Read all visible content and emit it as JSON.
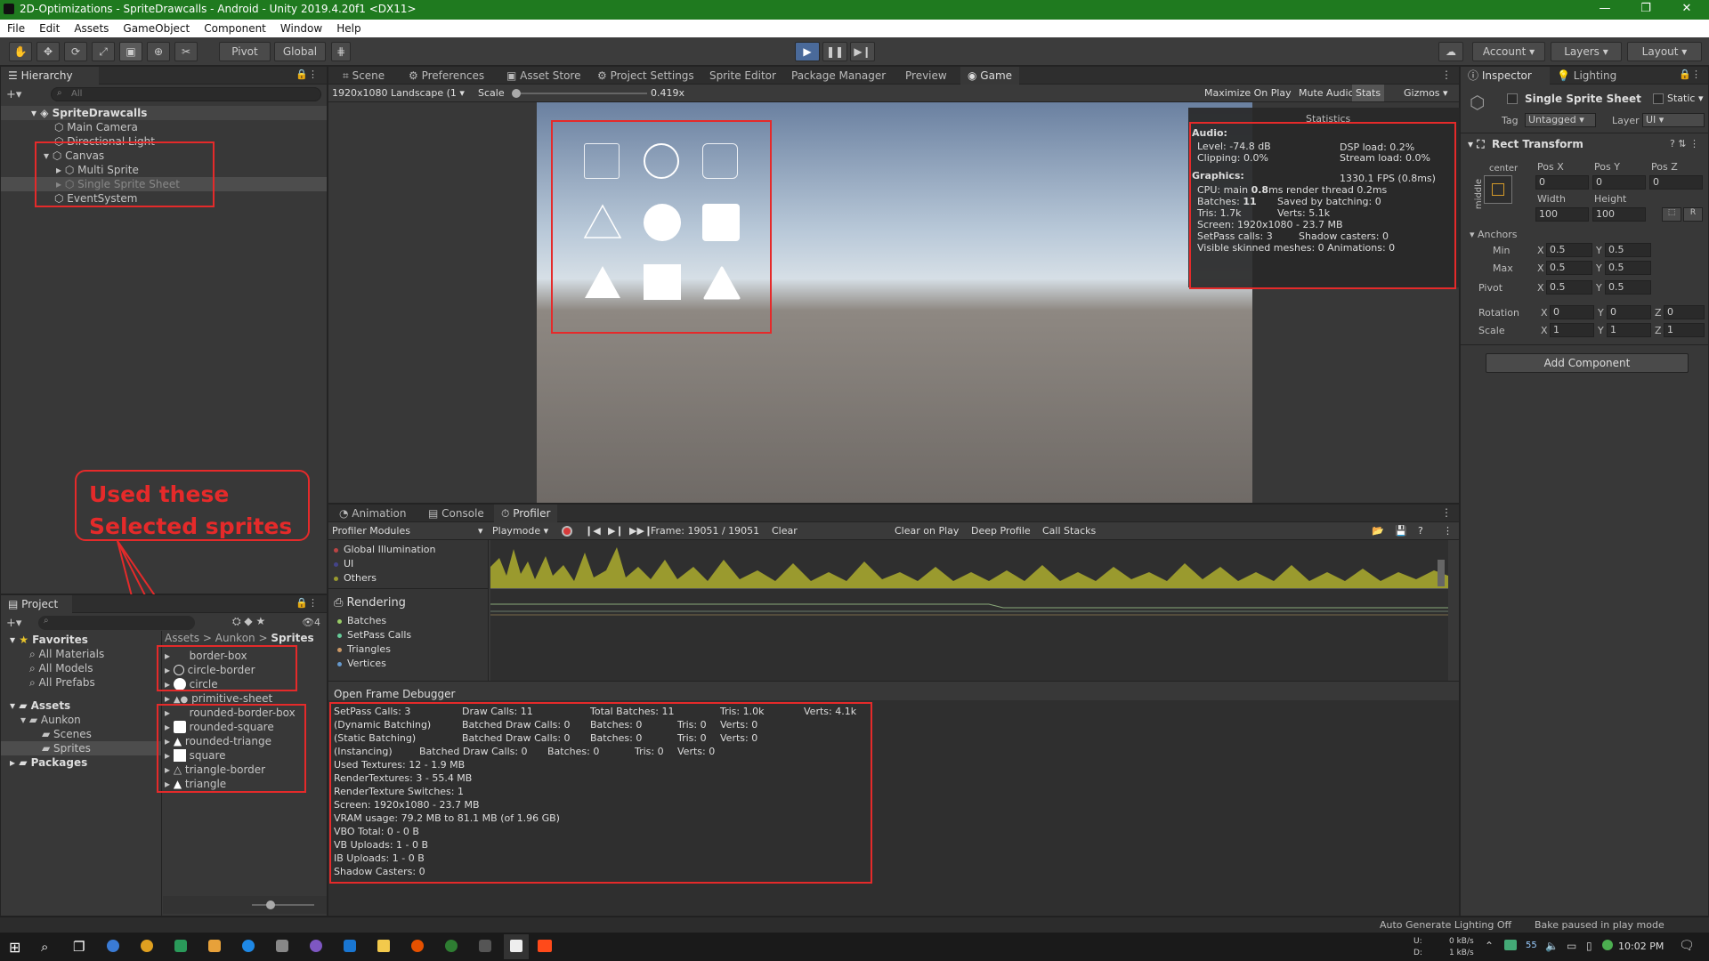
{
  "window": {
    "title": "2D-Optimizations - SpriteDrawcalls - Android - Unity 2019.4.20f1 <DX11>"
  },
  "menu": [
    "File",
    "Edit",
    "Assets",
    "GameObject",
    "Component",
    "Window",
    "Help"
  ],
  "toolbar": {
    "pivot": "Pivot",
    "global": "Global",
    "account": "Account",
    "layers": "Layers",
    "layout": "Layout"
  },
  "hierarchy": {
    "tab": "Hierarchy",
    "search_placeholder": "All",
    "items": [
      "SpriteDrawcalls",
      "Main Camera",
      "Directional Light",
      "Canvas",
      "Multi Sprite",
      "Single Sprite Sheet",
      "EventSystem"
    ]
  },
  "center_tabs": [
    "Scene",
    "Preferences",
    "Asset Store",
    "Project Settings",
    "Sprite Editor",
    "Package Manager",
    "Preview",
    "Game"
  ],
  "game_bar": {
    "resolution": "1920x1080 Landscape (1",
    "scale_label": "Scale",
    "scale_value": "0.419x",
    "maximize": "Maximize On Play",
    "mute": "Mute Audio",
    "stats": "Stats",
    "gizmos": "Gizmos"
  },
  "stats": {
    "title": "Statistics",
    "audio": "Audio:",
    "level": "Level: -74.8 dB",
    "dsp": "DSP load: 0.2%",
    "clipping": "Clipping: 0.0%",
    "stream": "Stream load: 0.0%",
    "graphics": "Graphics:",
    "fps": "1330.1 FPS (0.8ms)",
    "cpu_pre": "CPU: main ",
    "cpu_bold": "0.8",
    "cpu_post": "ms  render thread 0.2ms",
    "batches_pre": "Batches: ",
    "batches_bold": "11",
    "saved": "Saved by batching: 0",
    "tris": "Tris: 1.7k",
    "verts": "Verts: 5.1k",
    "screen": "Screen: 1920x1080 - 23.7 MB",
    "setpass": "SetPass calls: 3",
    "shadow": "Shadow casters: 0",
    "skinned": "Visible skinned meshes: 0  Animations: 0"
  },
  "inspector": {
    "tab": "Inspector",
    "lighting_tab": "Lighting",
    "object_name": "Single Sprite Sheet",
    "static": "Static",
    "tag_label": "Tag",
    "tag_value": "Untagged",
    "layer_label": "Layer",
    "layer_value": "UI",
    "component": "Rect Transform",
    "anchor_h": "center",
    "anchor_v": "middle",
    "posx": "Pos X",
    "posy": "Pos Y",
    "posz": "Pos Z",
    "posx_v": "0",
    "posy_v": "0",
    "posz_v": "0",
    "width": "Width",
    "height": "Height",
    "width_v": "100",
    "height_v": "100",
    "anchors": "Anchors",
    "min": "Min",
    "max": "Max",
    "pivot": "Pivot",
    "rotation": "Rotation",
    "scale": "Scale",
    "x": "X",
    "y": "Y",
    "z": "Z",
    "half": "0.5",
    "zero": "0",
    "one": "1",
    "add_component": "Add Component"
  },
  "bottom_tabs": [
    "Animation",
    "Console",
    "Profiler"
  ],
  "profiler": {
    "modules": "Profiler Modules",
    "playmode": "Playmode",
    "frame": "Frame: 19051 / 19051",
    "clear": "Clear",
    "clear_on_play": "Clear on Play",
    "deep": "Deep Profile",
    "call_stacks": "Call Stacks",
    "top_items": [
      "Global Illumination",
      "UI",
      "Others"
    ],
    "rendering": "Rendering",
    "render_items": [
      "Batches",
      "SetPass Calls",
      "Triangles",
      "Vertices"
    ],
    "open_debugger": "Open Frame Debugger",
    "details": [
      [
        "SetPass Calls: 3",
        "Draw Calls: 11",
        "Total Batches: 11",
        "Tris: 1.0k",
        "Verts: 4.1k"
      ],
      [
        "(Dynamic Batching)",
        "Batched Draw Calls: 0",
        "Batches: 0",
        "Tris: 0",
        "Verts: 0"
      ],
      [
        "(Static Batching)",
        "Batched Draw Calls: 0",
        "Batches: 0",
        "Tris: 0",
        "Verts: 0"
      ],
      [
        "(Instancing)",
        "Batched Draw Calls: 0",
        "Batches: 0",
        "Tris: 0",
        "Verts: 0"
      ]
    ],
    "details_lines": [
      "Used Textures: 12 - 1.9 MB",
      "RenderTextures: 3 - 55.4 MB",
      "RenderTexture Switches: 1",
      "Screen: 1920x1080 - 23.7 MB",
      "VRAM usage: 79.2 MB to 81.1 MB (of 1.96 GB)",
      "VBO Total: 0 - 0 B",
      "VB Uploads: 1 - 0 B",
      "IB Uploads: 1 - 0 B",
      "Shadow Casters: 0"
    ]
  },
  "project": {
    "tab": "Project",
    "count": "4",
    "favorites": "Favorites",
    "fav_items": [
      "All Materials",
      "All Models",
      "All Prefabs"
    ],
    "assets": "Assets",
    "tree": [
      "Aunkon",
      "Scenes",
      "Sprites"
    ],
    "packages": "Packages",
    "breadcrumb": [
      "Assets",
      "Aunkon",
      "Sprites"
    ],
    "files": [
      "border-box",
      "circle-border",
      "circle",
      "primitive-sheet",
      "rounded-border-box",
      "rounded-square",
      "rounded-triange",
      "square",
      "triangle-border",
      "triangle"
    ]
  },
  "annotation": "Used these Selected sprites",
  "status": {
    "lighting": "Auto Generate Lighting Off",
    "bake": "Bake paused in play mode"
  },
  "taskbar": {
    "net_u": "U:",
    "net_d": "D:",
    "up": "0 kB/s",
    "down": "1 kB/s",
    "badge": "55",
    "time": "10:02 PM"
  },
  "colors": {
    "title_green": "#1f7a1f",
    "annotation_red": "#e52a2a",
    "profiler_graph": "#9a9a2e"
  }
}
